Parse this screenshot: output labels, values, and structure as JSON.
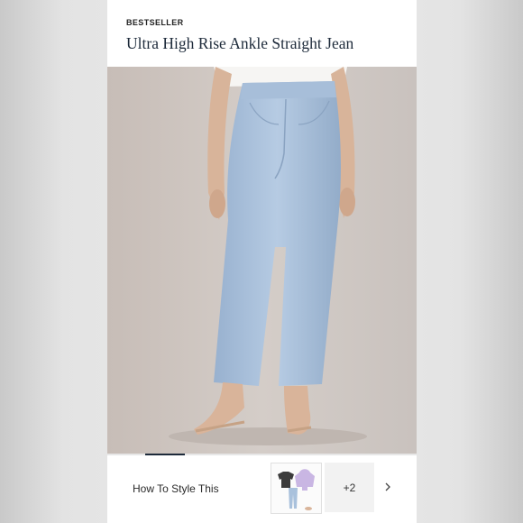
{
  "product": {
    "badge": "BESTSELLER",
    "title": "Ultra High Rise Ankle Straight Jean"
  },
  "gallery": {
    "image_alt": "model-wearing-light-wash-straight-jeans"
  },
  "style_section": {
    "label": "How To Style This",
    "more_count": "+2",
    "next_icon": "chevron-right-icon",
    "outfit_icon": "outfit-thumbnail"
  },
  "colors": {
    "title": "#1d2a3a",
    "denim": "#a9c1dc",
    "indicator": "#1d2a3a"
  }
}
